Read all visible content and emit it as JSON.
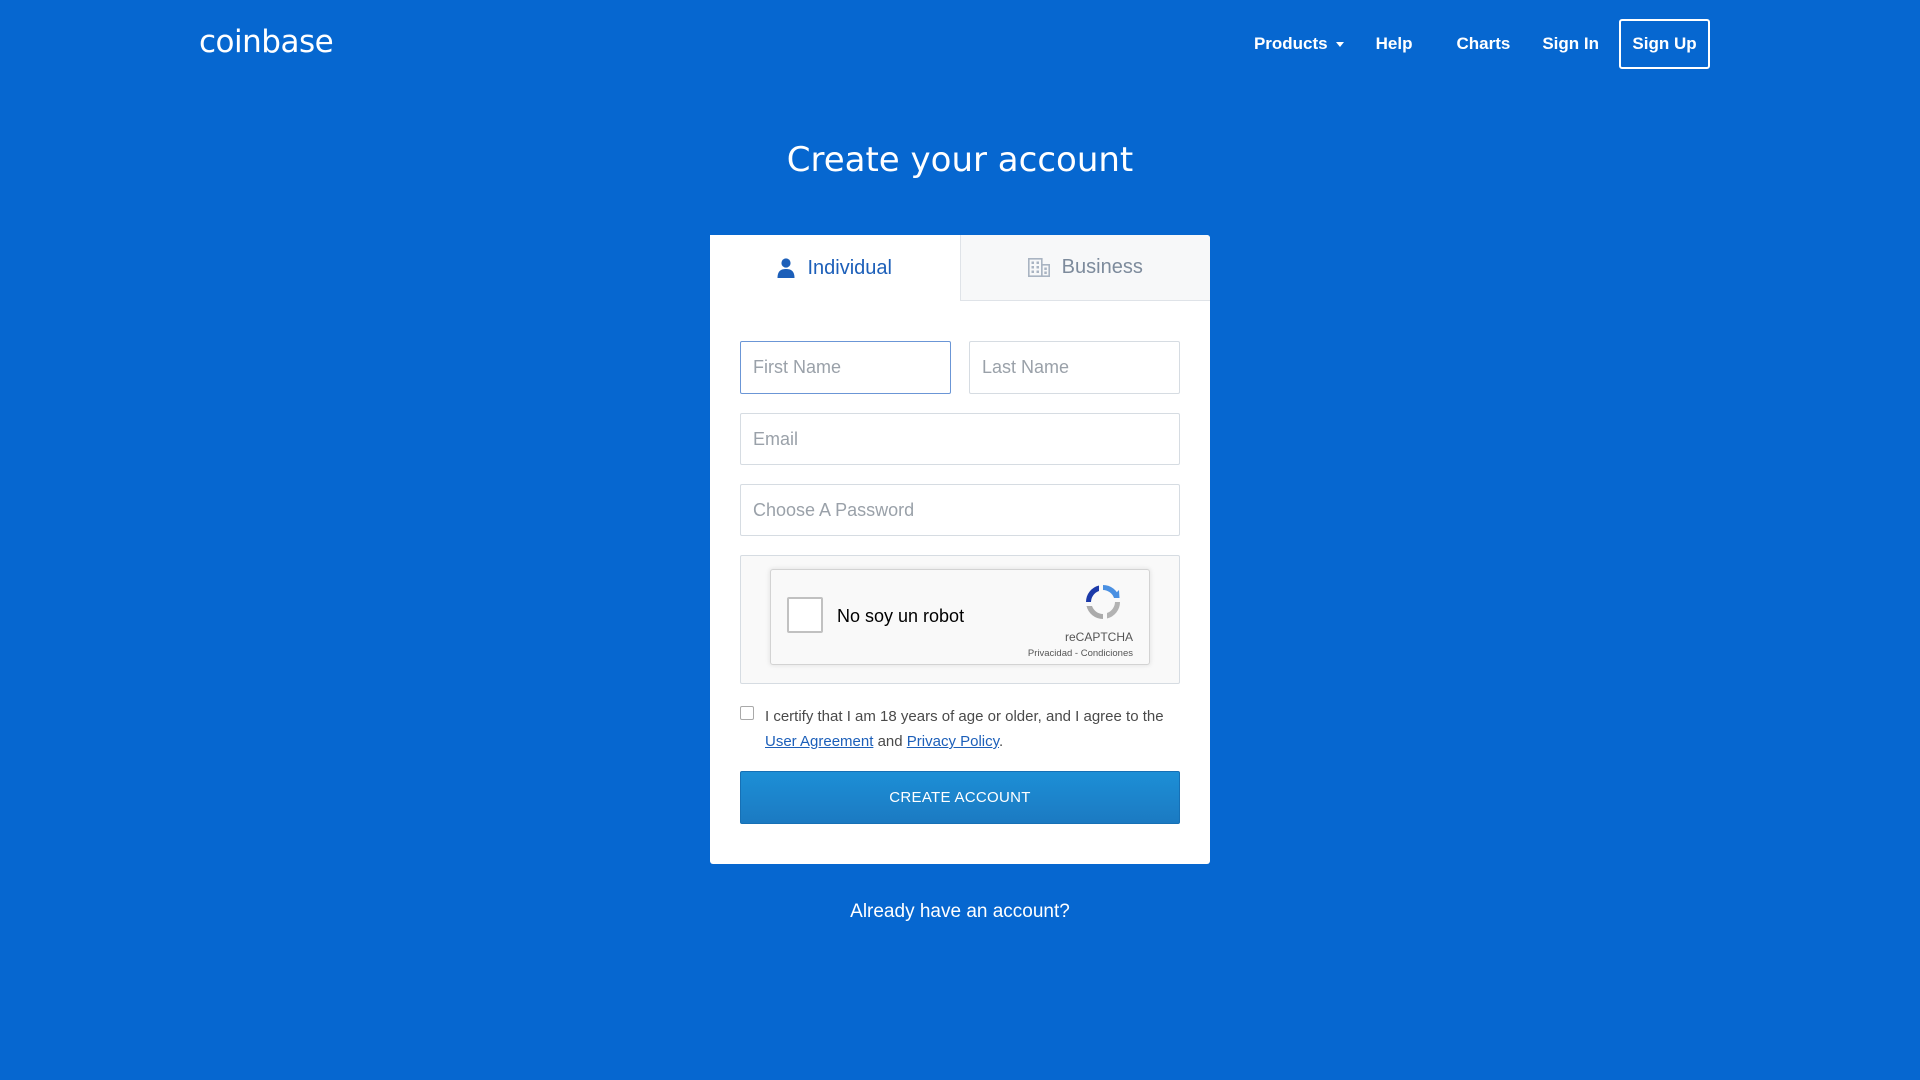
{
  "header": {
    "logo": "coinbase",
    "nav": {
      "products": "Products",
      "help": "Help",
      "charts": "Charts",
      "sign_in": "Sign In",
      "sign_up": "Sign Up"
    }
  },
  "page": {
    "title": "Create your account"
  },
  "tabs": {
    "individual": "Individual",
    "business": "Business",
    "active": "Individual"
  },
  "form": {
    "first_name": {
      "placeholder": "First Name",
      "value": ""
    },
    "last_name": {
      "placeholder": "Last Name",
      "value": ""
    },
    "email": {
      "placeholder": "Email",
      "value": ""
    },
    "password": {
      "placeholder": "Choose A Password",
      "value": ""
    }
  },
  "captcha": {
    "label": "No soy un robot",
    "brand": "reCAPTCHA",
    "links": "Privacidad - Condiciones",
    "checked": false
  },
  "terms": {
    "text_before": "I certify that I am 18 years of age or older, and I agree to the",
    "user_agreement": "User Agreement",
    "and": "and",
    "privacy_policy": "Privacy Policy",
    "period": ".",
    "checked": false
  },
  "submit": {
    "label": "CREATE ACCOUNT"
  },
  "footer": {
    "already": "Already have an account?"
  },
  "colors": {
    "background": "#0667d0",
    "accent": "#1c5fb9",
    "button": "#1b84cc"
  },
  "icons": {
    "individual_tab": "user-icon",
    "business_tab": "building-icon",
    "products_dropdown": "caret-down-icon",
    "captcha": "recaptcha-icon"
  }
}
